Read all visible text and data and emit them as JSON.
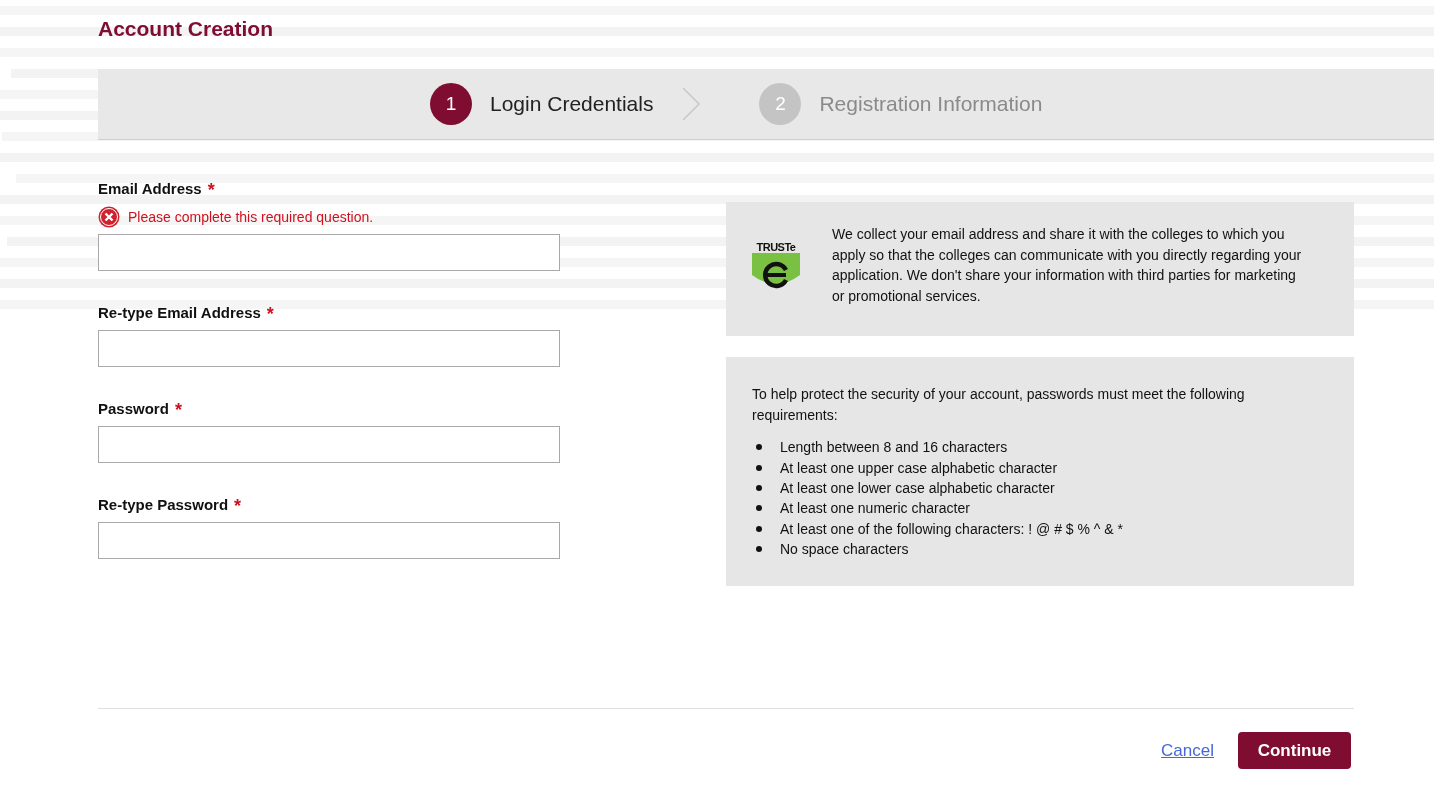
{
  "title": "Account Creation",
  "steps": [
    {
      "number": "1",
      "label": "Login Credentials",
      "selected": true
    },
    {
      "number": "2",
      "label": "Registration Information",
      "selected": false
    }
  ],
  "fields": [
    {
      "label": "Email Address",
      "required_mark": "*",
      "error": "Please complete this required question."
    },
    {
      "label": "Re-type Email Address",
      "required_mark": "*"
    },
    {
      "label": "Password",
      "required_mark": "*"
    },
    {
      "label": "Re-type Password",
      "required_mark": "*"
    }
  ],
  "privacy_notice": {
    "logo_text": "TRUSTe",
    "text": "We collect your email address and share it with the colleges to which you apply so that the colleges can communicate with you directly regarding your application. We don't share your information with third parties for marketing or promotional services."
  },
  "password_rules": {
    "intro": "To help protect the security of your account, passwords must meet the following requirements:",
    "items": [
      "Length between 8 and 16 characters",
      "At least one upper case alphabetic character",
      "At least one lower case alphabetic character",
      "At least one numeric character",
      "At least one of the following characters: ! @ # $ % ^ & *",
      "No space characters"
    ]
  },
  "actions": {
    "cancel": "Cancel",
    "continue": "Continue"
  }
}
